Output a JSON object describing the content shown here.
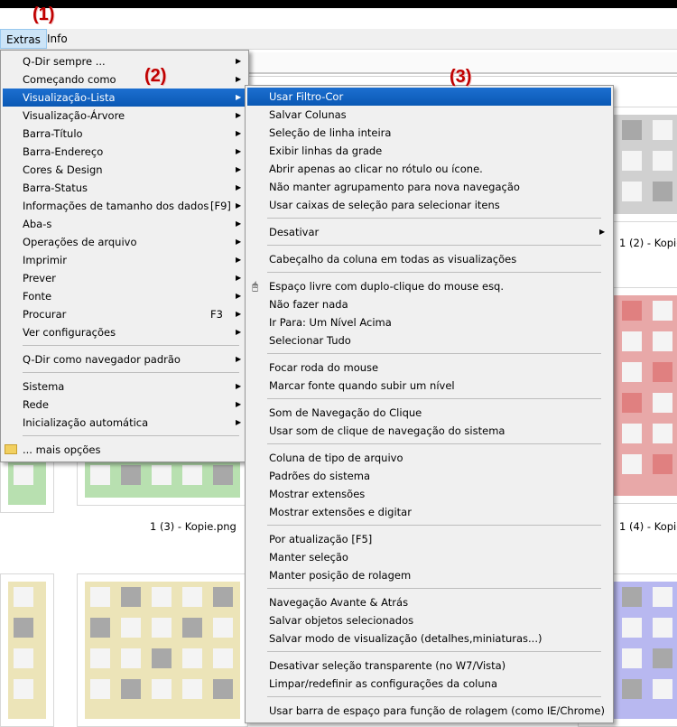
{
  "callouts": [
    "(1)",
    "(2)",
    "(3)"
  ],
  "menubar": {
    "extras": "Extras",
    "info": "Info"
  },
  "captions": [
    "1 (2) - Kopie",
    "1 (3) - Kopie.png",
    "1 (4) - Kopie"
  ],
  "colors": {
    "highlight": "#0a64c8",
    "callout": "#c00000",
    "thumb_gray": "#d0d0d0",
    "thumb_green": "#b8e0b0",
    "thumb_red": "#e8a8a8",
    "thumb_yellow": "#ece4b8",
    "thumb_blue": "#b8b8f0"
  },
  "menu1": {
    "items": [
      {
        "label": "Q-Dir sempre ...",
        "shortcut": "",
        "arrow": true
      },
      {
        "label": "Começando como",
        "shortcut": "",
        "arrow": true
      },
      {
        "label": "Visualização-Lista",
        "shortcut": "",
        "arrow": true
      },
      {
        "label": "Visualização-Árvore",
        "shortcut": "",
        "arrow": true
      },
      {
        "label": "Barra-Título",
        "shortcut": "",
        "arrow": true
      },
      {
        "label": "Barra-Endereço",
        "shortcut": "",
        "arrow": true
      },
      {
        "label": "Cores & Design",
        "shortcut": "",
        "arrow": true
      },
      {
        "label": "Barra-Status",
        "shortcut": "",
        "arrow": true
      },
      {
        "label": "Informações de tamanho dos dados",
        "shortcut": "[F9]",
        "arrow": true
      },
      {
        "label": "Aba-s",
        "shortcut": "",
        "arrow": true
      },
      {
        "label": "Operações de arquivo",
        "shortcut": "",
        "arrow": true
      },
      {
        "label": "Imprimir",
        "shortcut": "",
        "arrow": true
      },
      {
        "label": "Prever",
        "shortcut": "",
        "arrow": true
      },
      {
        "label": "Fonte",
        "shortcut": "",
        "arrow": true
      },
      {
        "label": "Procurar",
        "shortcut": "F3",
        "arrow": true
      },
      {
        "label": "Ver configurações",
        "shortcut": "",
        "arrow": true
      },
      {
        "label": "Q-Dir como navegador padrão",
        "shortcut": "",
        "arrow": true
      },
      {
        "label": "Sistema",
        "shortcut": "",
        "arrow": true
      },
      {
        "label": "Rede",
        "shortcut": "",
        "arrow": true
      },
      {
        "label": "Inicialização automática",
        "shortcut": "",
        "arrow": true
      },
      {
        "label": "... mais opções",
        "shortcut": "",
        "arrow": false
      }
    ]
  },
  "menu2": {
    "items": [
      {
        "label": "Usar Filtro-Cor"
      },
      {
        "label": "Salvar Colunas"
      },
      {
        "label": "Seleção de linha inteira"
      },
      {
        "label": "Exibir linhas da grade"
      },
      {
        "label": "Abrir apenas ao clicar no rótulo ou ícone."
      },
      {
        "label": "Não manter agrupamento para nova navegação"
      },
      {
        "label": "Usar caixas de seleção para selecionar itens"
      },
      {
        "label": "Desativar"
      },
      {
        "label": "Cabeçalho da coluna em todas as visualizações"
      },
      {
        "label": "Espaço livre com duplo-clique do mouse esq."
      },
      {
        "label": "Não fazer nada"
      },
      {
        "label": "Ir Para: Um Nível Acima"
      },
      {
        "label": "Selecionar Tudo"
      },
      {
        "label": "Focar roda do mouse"
      },
      {
        "label": "Marcar fonte quando subir um nível"
      },
      {
        "label": "Som de Navegação do Clique"
      },
      {
        "label": "Usar som de clique de navegação do sistema"
      },
      {
        "label": "Coluna de tipo de arquivo"
      },
      {
        "label": "Padrões do sistema"
      },
      {
        "label": "Mostrar extensões"
      },
      {
        "label": "Mostrar extensões e digitar"
      },
      {
        "label": "Por atualização [F5]"
      },
      {
        "label": "Manter seleção"
      },
      {
        "label": "Manter posição de rolagem"
      },
      {
        "label": "Navegação Avante & Atrás"
      },
      {
        "label": "Salvar objetos selecionados"
      },
      {
        "label": "Salvar modo de visualização (detalhes,miniaturas...)"
      },
      {
        "label": "Desativar seleção transparente (no W7/Vista)"
      },
      {
        "label": "Limpar/redefinir as configurações da coluna"
      },
      {
        "label": "Usar barra de espaço para função de rolagem (como IE/Chrome)"
      }
    ]
  }
}
